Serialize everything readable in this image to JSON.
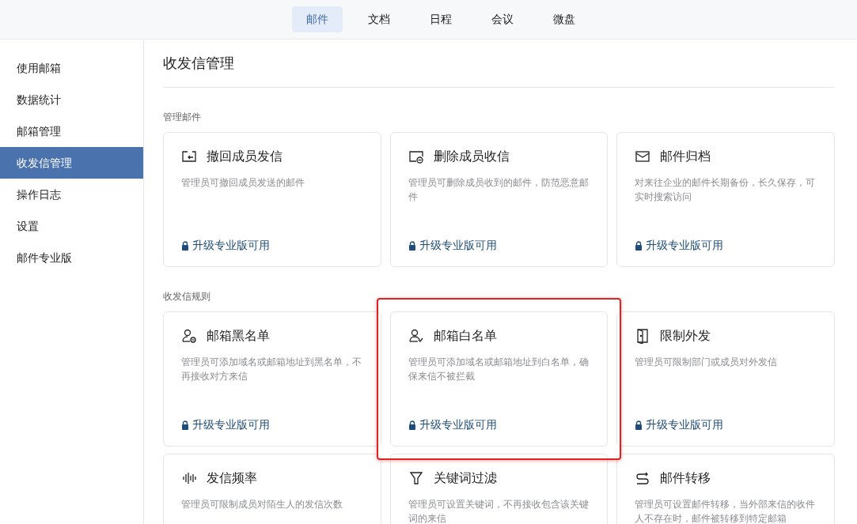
{
  "top_tabs": [
    {
      "label": "邮件",
      "selected": true
    },
    {
      "label": "文档",
      "selected": false
    },
    {
      "label": "日程",
      "selected": false
    },
    {
      "label": "会议",
      "selected": false
    },
    {
      "label": "微盘",
      "selected": false
    }
  ],
  "sidebar": {
    "items": [
      {
        "label": "使用邮箱",
        "selected": false
      },
      {
        "label": "数据统计",
        "selected": false
      },
      {
        "label": "邮箱管理",
        "selected": false
      },
      {
        "label": "收发信管理",
        "selected": true
      },
      {
        "label": "操作日志",
        "selected": false
      },
      {
        "label": "设置",
        "selected": false
      },
      {
        "label": "邮件专业版",
        "selected": false
      }
    ]
  },
  "page_title": "收发信管理",
  "sections": [
    {
      "label": "管理邮件",
      "cards": [
        {
          "kind": "recall",
          "title": "撤回成员发信",
          "description": "管理员可撤回成员发送的邮件",
          "upgrade": "升级专业版可用",
          "highlighted": false
        },
        {
          "kind": "delete",
          "title": "删除成员收信",
          "description": "管理员可删除成员收到的邮件，防范恶意邮件",
          "upgrade": "升级专业版可用",
          "highlighted": false
        },
        {
          "kind": "archive",
          "title": "邮件归档",
          "description": "对来往企业的邮件长期备份，长久保存，可实时搜索访问",
          "upgrade": "升级专业版可用",
          "highlighted": false
        }
      ]
    },
    {
      "label": "收发信规则",
      "cards": [
        {
          "kind": "blacklist",
          "title": "邮箱黑名单",
          "description": "管理员可添加域名或邮箱地址到黑名单，不再接收对方来信",
          "upgrade": "升级专业版可用",
          "highlighted": false
        },
        {
          "kind": "whitelist",
          "title": "邮箱白名单",
          "description": "管理员可添加域名或邮箱地址到白名单，确保来信不被拦截",
          "upgrade": "升级专业版可用",
          "highlighted": true
        },
        {
          "kind": "restrict",
          "title": "限制外发",
          "description": "管理员可限制部门或成员对外发信",
          "upgrade": "升级专业版可用",
          "highlighted": false
        },
        {
          "kind": "frequency",
          "title": "发信频率",
          "description": "管理员可限制成员对陌生人的发信次数",
          "highlighted": false
        },
        {
          "kind": "filter",
          "title": "关键词过滤",
          "description": "管理员可设置关键词，不再接收包含该关键词的来信",
          "highlighted": false
        },
        {
          "kind": "transfer",
          "title": "邮件转移",
          "description": "管理员可设置邮件转移，当外部来信的收件人不存在时，邮件被转移到特定邮箱",
          "highlighted": false
        }
      ]
    }
  ]
}
